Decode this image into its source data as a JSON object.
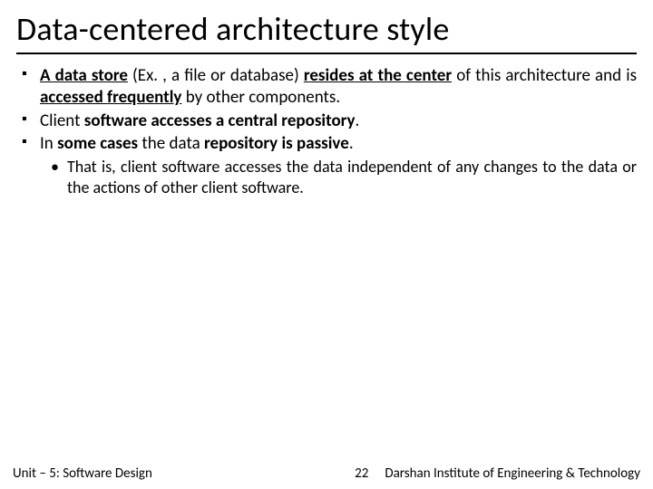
{
  "title": "Data-centered architecture style",
  "bullets": {
    "b1": {
      "t1": "A data store",
      "t2": " (Ex. , a file or database) ",
      "t3": "resides at the center",
      "t4": " of this architecture and is ",
      "t5": "accessed frequently",
      "t6": " by other components."
    },
    "b2": {
      "t1": "Client ",
      "t2": "software accesses a central repository",
      "t3": "."
    },
    "b3": {
      "t1": "In ",
      "t2": "some cases",
      "t3": " the data ",
      "t4": "repository is passive",
      "t5": "."
    },
    "sub1": "That is, client software accesses the data independent of any changes to the data or the actions of other client software."
  },
  "footer": {
    "unit": "Unit – 5: Software Design",
    "page": "22",
    "institute": "Darshan Institute of Engineering & Technology"
  }
}
